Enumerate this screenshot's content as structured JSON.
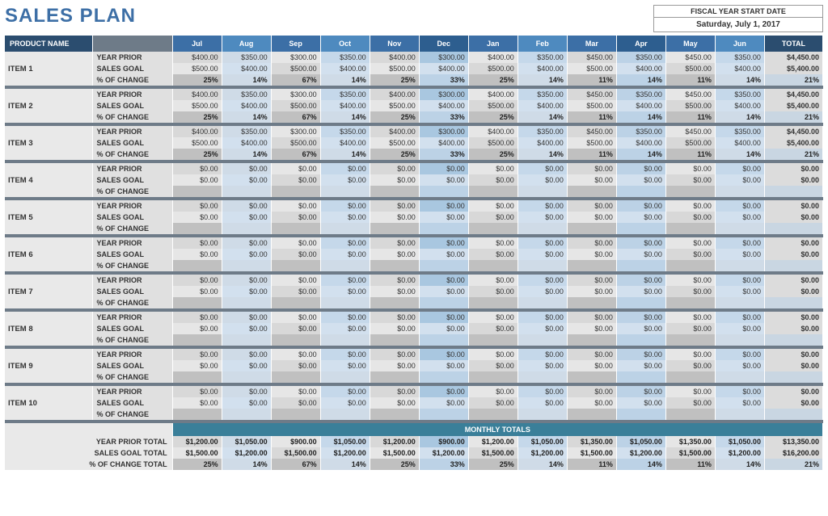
{
  "header": {
    "title": "SALES PLAN",
    "fiscal_label": "FISCAL YEAR START DATE",
    "fiscal_date": "Saturday, July 1, 2017"
  },
  "columns": {
    "product": "PRODUCT NAME",
    "months": [
      "Jul",
      "Aug",
      "Sep",
      "Oct",
      "Nov",
      "Dec",
      "Jan",
      "Feb",
      "Mar",
      "Apr",
      "May",
      "Jun"
    ],
    "total": "TOTAL"
  },
  "metric_labels": {
    "prior": "YEAR PRIOR",
    "goal": "SALES GOAL",
    "pct": "% OF CHANGE"
  },
  "items": [
    {
      "name": "ITEM 1",
      "prior": [
        "$400.00",
        "$350.00",
        "$300.00",
        "$350.00",
        "$400.00",
        "$300.00",
        "$400.00",
        "$350.00",
        "$450.00",
        "$350.00",
        "$450.00",
        "$350.00",
        "$4,450.00"
      ],
      "goal": [
        "$500.00",
        "$400.00",
        "$500.00",
        "$400.00",
        "$500.00",
        "$400.00",
        "$500.00",
        "$400.00",
        "$500.00",
        "$400.00",
        "$500.00",
        "$400.00",
        "$5,400.00"
      ],
      "pct": [
        "25%",
        "14%",
        "67%",
        "14%",
        "25%",
        "33%",
        "25%",
        "14%",
        "11%",
        "14%",
        "11%",
        "14%",
        "21%"
      ]
    },
    {
      "name": "ITEM 2",
      "prior": [
        "$400.00",
        "$350.00",
        "$300.00",
        "$350.00",
        "$400.00",
        "$300.00",
        "$400.00",
        "$350.00",
        "$450.00",
        "$350.00",
        "$450.00",
        "$350.00",
        "$4,450.00"
      ],
      "goal": [
        "$500.00",
        "$400.00",
        "$500.00",
        "$400.00",
        "$500.00",
        "$400.00",
        "$500.00",
        "$400.00",
        "$500.00",
        "$400.00",
        "$500.00",
        "$400.00",
        "$5,400.00"
      ],
      "pct": [
        "25%",
        "14%",
        "67%",
        "14%",
        "25%",
        "33%",
        "25%",
        "14%",
        "11%",
        "14%",
        "11%",
        "14%",
        "21%"
      ]
    },
    {
      "name": "ITEM 3",
      "prior": [
        "$400.00",
        "$350.00",
        "$300.00",
        "$350.00",
        "$400.00",
        "$300.00",
        "$400.00",
        "$350.00",
        "$450.00",
        "$350.00",
        "$450.00",
        "$350.00",
        "$4,450.00"
      ],
      "goal": [
        "$500.00",
        "$400.00",
        "$500.00",
        "$400.00",
        "$500.00",
        "$400.00",
        "$500.00",
        "$400.00",
        "$500.00",
        "$400.00",
        "$500.00",
        "$400.00",
        "$5,400.00"
      ],
      "pct": [
        "25%",
        "14%",
        "67%",
        "14%",
        "25%",
        "33%",
        "25%",
        "14%",
        "11%",
        "14%",
        "11%",
        "14%",
        "21%"
      ]
    },
    {
      "name": "ITEM 4",
      "prior": [
        "$0.00",
        "$0.00",
        "$0.00",
        "$0.00",
        "$0.00",
        "$0.00",
        "$0.00",
        "$0.00",
        "$0.00",
        "$0.00",
        "$0.00",
        "$0.00",
        "$0.00"
      ],
      "goal": [
        "$0.00",
        "$0.00",
        "$0.00",
        "$0.00",
        "$0.00",
        "$0.00",
        "$0.00",
        "$0.00",
        "$0.00",
        "$0.00",
        "$0.00",
        "$0.00",
        "$0.00"
      ],
      "pct": [
        "",
        "",
        "",
        "",
        "",
        "",
        "",
        "",
        "",
        "",
        "",
        "",
        ""
      ]
    },
    {
      "name": "ITEM 5",
      "prior": [
        "$0.00",
        "$0.00",
        "$0.00",
        "$0.00",
        "$0.00",
        "$0.00",
        "$0.00",
        "$0.00",
        "$0.00",
        "$0.00",
        "$0.00",
        "$0.00",
        "$0.00"
      ],
      "goal": [
        "$0.00",
        "$0.00",
        "$0.00",
        "$0.00",
        "$0.00",
        "$0.00",
        "$0.00",
        "$0.00",
        "$0.00",
        "$0.00",
        "$0.00",
        "$0.00",
        "$0.00"
      ],
      "pct": [
        "",
        "",
        "",
        "",
        "",
        "",
        "",
        "",
        "",
        "",
        "",
        "",
        ""
      ]
    },
    {
      "name": "ITEM 6",
      "prior": [
        "$0.00",
        "$0.00",
        "$0.00",
        "$0.00",
        "$0.00",
        "$0.00",
        "$0.00",
        "$0.00",
        "$0.00",
        "$0.00",
        "$0.00",
        "$0.00",
        "$0.00"
      ],
      "goal": [
        "$0.00",
        "$0.00",
        "$0.00",
        "$0.00",
        "$0.00",
        "$0.00",
        "$0.00",
        "$0.00",
        "$0.00",
        "$0.00",
        "$0.00",
        "$0.00",
        "$0.00"
      ],
      "pct": [
        "",
        "",
        "",
        "",
        "",
        "",
        "",
        "",
        "",
        "",
        "",
        "",
        ""
      ]
    },
    {
      "name": "ITEM 7",
      "prior": [
        "$0.00",
        "$0.00",
        "$0.00",
        "$0.00",
        "$0.00",
        "$0.00",
        "$0.00",
        "$0.00",
        "$0.00",
        "$0.00",
        "$0.00",
        "$0.00",
        "$0.00"
      ],
      "goal": [
        "$0.00",
        "$0.00",
        "$0.00",
        "$0.00",
        "$0.00",
        "$0.00",
        "$0.00",
        "$0.00",
        "$0.00",
        "$0.00",
        "$0.00",
        "$0.00",
        "$0.00"
      ],
      "pct": [
        "",
        "",
        "",
        "",
        "",
        "",
        "",
        "",
        "",
        "",
        "",
        "",
        ""
      ]
    },
    {
      "name": "ITEM 8",
      "prior": [
        "$0.00",
        "$0.00",
        "$0.00",
        "$0.00",
        "$0.00",
        "$0.00",
        "$0.00",
        "$0.00",
        "$0.00",
        "$0.00",
        "$0.00",
        "$0.00",
        "$0.00"
      ],
      "goal": [
        "$0.00",
        "$0.00",
        "$0.00",
        "$0.00",
        "$0.00",
        "$0.00",
        "$0.00",
        "$0.00",
        "$0.00",
        "$0.00",
        "$0.00",
        "$0.00",
        "$0.00"
      ],
      "pct": [
        "",
        "",
        "",
        "",
        "",
        "",
        "",
        "",
        "",
        "",
        "",
        "",
        ""
      ]
    },
    {
      "name": "ITEM 9",
      "prior": [
        "$0.00",
        "$0.00",
        "$0.00",
        "$0.00",
        "$0.00",
        "$0.00",
        "$0.00",
        "$0.00",
        "$0.00",
        "$0.00",
        "$0.00",
        "$0.00",
        "$0.00"
      ],
      "goal": [
        "$0.00",
        "$0.00",
        "$0.00",
        "$0.00",
        "$0.00",
        "$0.00",
        "$0.00",
        "$0.00",
        "$0.00",
        "$0.00",
        "$0.00",
        "$0.00",
        "$0.00"
      ],
      "pct": [
        "",
        "",
        "",
        "",
        "",
        "",
        "",
        "",
        "",
        "",
        "",
        "",
        ""
      ]
    },
    {
      "name": "ITEM 10",
      "prior": [
        "$0.00",
        "$0.00",
        "$0.00",
        "$0.00",
        "$0.00",
        "$0.00",
        "$0.00",
        "$0.00",
        "$0.00",
        "$0.00",
        "$0.00",
        "$0.00",
        "$0.00"
      ],
      "goal": [
        "$0.00",
        "$0.00",
        "$0.00",
        "$0.00",
        "$0.00",
        "$0.00",
        "$0.00",
        "$0.00",
        "$0.00",
        "$0.00",
        "$0.00",
        "$0.00",
        "$0.00"
      ],
      "pct": [
        "",
        "",
        "",
        "",
        "",
        "",
        "",
        "",
        "",
        "",
        "",
        "",
        ""
      ]
    }
  ],
  "totals": {
    "heading": "MONTHLY TOTALS",
    "labels": {
      "prior": "YEAR PRIOR TOTAL",
      "goal": "SALES GOAL TOTAL",
      "pct": "% OF CHANGE TOTAL"
    },
    "prior": [
      "$1,200.00",
      "$1,050.00",
      "$900.00",
      "$1,050.00",
      "$1,200.00",
      "$900.00",
      "$1,200.00",
      "$1,050.00",
      "$1,350.00",
      "$1,050.00",
      "$1,350.00",
      "$1,050.00",
      "$13,350.00"
    ],
    "goal": [
      "$1,500.00",
      "$1,200.00",
      "$1,500.00",
      "$1,200.00",
      "$1,500.00",
      "$1,200.00",
      "$1,500.00",
      "$1,200.00",
      "$1,500.00",
      "$1,200.00",
      "$1,500.00",
      "$1,200.00",
      "$16,200.00"
    ],
    "pct": [
      "25%",
      "14%",
      "67%",
      "14%",
      "25%",
      "33%",
      "25%",
      "14%",
      "11%",
      "14%",
      "11%",
      "14%",
      "21%"
    ]
  }
}
